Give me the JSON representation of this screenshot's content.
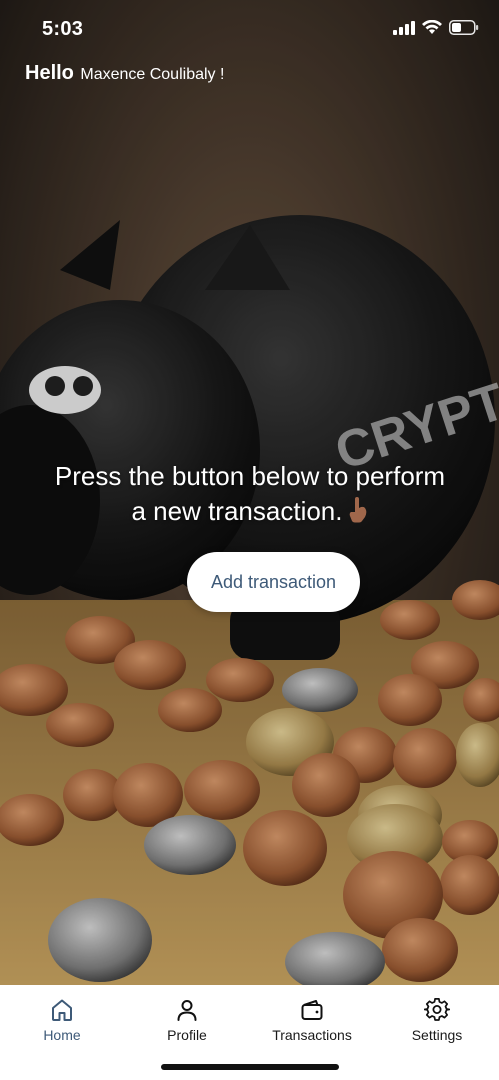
{
  "status_bar": {
    "time": "5:03",
    "battery_icon": "battery-icon",
    "wifi_icon": "wifi-icon",
    "signal_icon": "signal-icon"
  },
  "greeting": {
    "hello": "Hello",
    "name": "Maxence Coulibaly !"
  },
  "main": {
    "message_line1": "Press the button below to perform",
    "message_line2": "a new transaction.",
    "message_icon": "pointing-down-hand-icon",
    "add_button_label": "Add transaction"
  },
  "tab_bar": {
    "active_color": "#3e5a78",
    "tabs": [
      {
        "label": "Home",
        "icon": "home-icon",
        "active": true
      },
      {
        "label": "Profile",
        "icon": "person-icon",
        "active": false
      },
      {
        "label": "Transactions",
        "icon": "wallet-icon",
        "active": false
      },
      {
        "label": "Settings",
        "icon": "gear-icon",
        "active": false
      }
    ]
  },
  "background_image": "piggy-bank-crypto-coins-photo"
}
